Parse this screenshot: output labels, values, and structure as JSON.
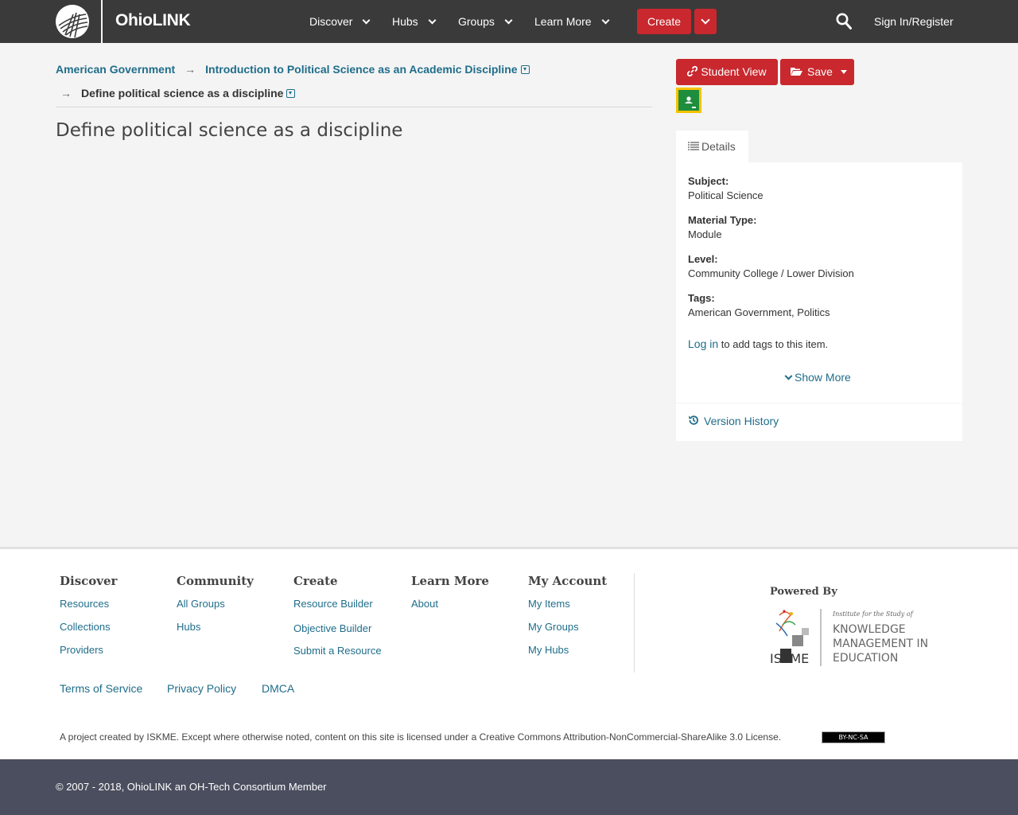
{
  "header": {
    "brand": "OhioLINK",
    "nav": [
      {
        "label": "Discover"
      },
      {
        "label": "Hubs"
      },
      {
        "label": "Groups"
      },
      {
        "label": "Learn More"
      }
    ],
    "create_label": "Create",
    "signin_label": "Sign In/Register"
  },
  "breadcrumb": {
    "level1": "American Government",
    "level2": "Introduction to Political Science as an Academic Discipline",
    "level3": "Define political science as a discipline",
    "arrow": "→"
  },
  "page_title": "Define political science as a discipline",
  "actions": {
    "student_view": "Student View",
    "save": "Save"
  },
  "details": {
    "tab_label": "Details",
    "fields": [
      {
        "label": "Subject:",
        "value": "Political Science"
      },
      {
        "label": "Material Type:",
        "value": "Module"
      },
      {
        "label": "Level:",
        "value": "Community College / Lower Division"
      },
      {
        "label": "Tags:",
        "value": "American Government, Politics"
      }
    ],
    "login_link": "Log in",
    "login_suffix": " to add tags to this item.",
    "show_more": "Show More",
    "version_history": "Version History"
  },
  "footer": {
    "columns": [
      {
        "heading": "Discover",
        "links": [
          "Resources",
          "Collections",
          "Providers"
        ]
      },
      {
        "heading": "Community",
        "links": [
          "All Groups",
          "Hubs"
        ]
      },
      {
        "heading": "Create",
        "links": [
          "Resource Builder",
          "Objective Builder",
          "Submit a Resource"
        ]
      },
      {
        "heading": "Learn More",
        "links": [
          "About"
        ]
      },
      {
        "heading": "My Account",
        "links": [
          "My Items",
          "My Groups",
          "My Hubs"
        ]
      }
    ],
    "powered_by": "Powered By",
    "iskme_logo_text": [
      "Institute for the Study of",
      "KNOWLEDGE",
      "MANAGEMENT IN",
      "EDUCATION",
      "ISKME"
    ],
    "legal_links": [
      "Terms of Service",
      "Privacy Policy",
      "DMCA"
    ],
    "license_text": "A project created by ISKME. Except where otherwise noted, content on this site is licensed under a Creative Commons Attribution-NonCommercial-ShareAlike 3.0 License.",
    "cc_badge": "BY-NC-SA",
    "copyright": "© 2007 - 2018, OhioLINK an OH-Tech Consortium Member"
  },
  "colors": {
    "topbar": "#3a3a3a",
    "accent_red": "#c8282e",
    "link_blue": "#1f6d8a",
    "page_bg": "#f4f4f4",
    "bottom_bar": "#4a4e5e"
  }
}
